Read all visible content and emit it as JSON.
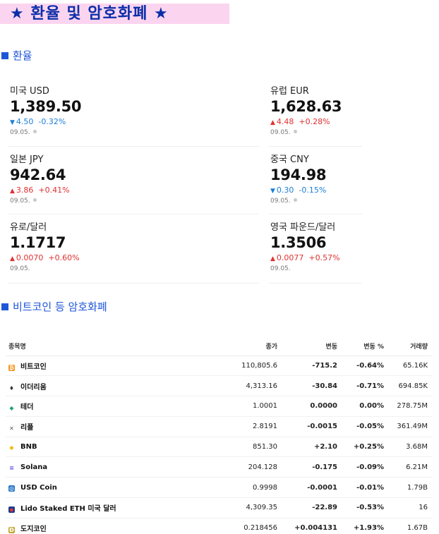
{
  "banner": {
    "title": "★ 환율 및 암호화폐 ★"
  },
  "sections": {
    "fx_title": "환율",
    "crypto_title": "비트코인 등 암호화폐"
  },
  "fx": [
    {
      "name": "미국 USD",
      "value": "1,389.50",
      "dir": "down",
      "change": "4.50",
      "pct": "-0.32%",
      "date": "09.05.",
      "live": true
    },
    {
      "name": "유럽 EUR",
      "value": "1,628.63",
      "dir": "up",
      "change": "4.48",
      "pct": "+0.28%",
      "date": "09.05.",
      "live": true
    },
    {
      "name": "일본 JPY",
      "value": "942.64",
      "dir": "up",
      "change": "3.86",
      "pct": "+0.41%",
      "date": "09.05.",
      "live": true
    },
    {
      "name": "중국 CNY",
      "value": "194.98",
      "dir": "down",
      "change": "0.30",
      "pct": "-0.15%",
      "date": "09.05.",
      "live": true
    },
    {
      "name": "유로/달러",
      "value": "1.1717",
      "dir": "up",
      "change": "0.0070",
      "pct": "+0.60%",
      "date": "09.05.",
      "live": false
    },
    {
      "name": "영국 파운드/달러",
      "value": "1.3506",
      "dir": "up",
      "change": "0.0077",
      "pct": "+0.57%",
      "date": "09.05.",
      "live": false
    }
  ],
  "crypto": {
    "headers": {
      "name": "종목명",
      "price": "종가",
      "change": "변동",
      "pct": "변동 %",
      "volume": "거래량"
    },
    "rows": [
      {
        "icon": "bitcoin-icon",
        "name": "비트코인",
        "price": "110,805.6",
        "change": "-715.2",
        "pct": "-0.64%",
        "volume": "65.16K",
        "dir": "down"
      },
      {
        "icon": "ethereum-icon",
        "name": "이더리움",
        "price": "4,313.16",
        "change": "-30.84",
        "pct": "-0.71%",
        "volume": "694.85K",
        "dir": "down"
      },
      {
        "icon": "tether-icon",
        "name": "테더",
        "price": "1.0001",
        "change": "0.0000",
        "pct": "0.00%",
        "volume": "278.75M",
        "dir": "flat"
      },
      {
        "icon": "ripple-icon",
        "name": "리플",
        "price": "2.8191",
        "change": "-0.0015",
        "pct": "-0.05%",
        "volume": "361.49M",
        "dir": "down"
      },
      {
        "icon": "bnb-icon",
        "name": "BNB",
        "price": "851.30",
        "change": "+2.10",
        "pct": "+0.25%",
        "volume": "3.68M",
        "dir": "up"
      },
      {
        "icon": "solana-icon",
        "name": "Solana",
        "price": "204.128",
        "change": "-0.175",
        "pct": "-0.09%",
        "volume": "6.21M",
        "dir": "down"
      },
      {
        "icon": "usd-coin-icon",
        "name": "USD Coin",
        "price": "0.9998",
        "change": "-0.0001",
        "pct": "-0.01%",
        "volume": "1.79B",
        "dir": "down"
      },
      {
        "icon": "lido-steth-icon",
        "name": "Lido Staked ETH 미국 달러",
        "price": "4,309.35",
        "change": "-22.89",
        "pct": "-0.53%",
        "volume": "16",
        "dir": "down"
      },
      {
        "icon": "dogecoin-icon",
        "name": "도지코인",
        "price": "0.218456",
        "change": "+0.004131",
        "pct": "+1.93%",
        "volume": "1.67B",
        "dir": "up"
      }
    ]
  },
  "colors": {
    "up": "#e03131",
    "down": "#1c7ed6",
    "accent": "#1e56d8",
    "banner_bg": "#fbd5f0",
    "banner_text": "#0b2ea8"
  }
}
